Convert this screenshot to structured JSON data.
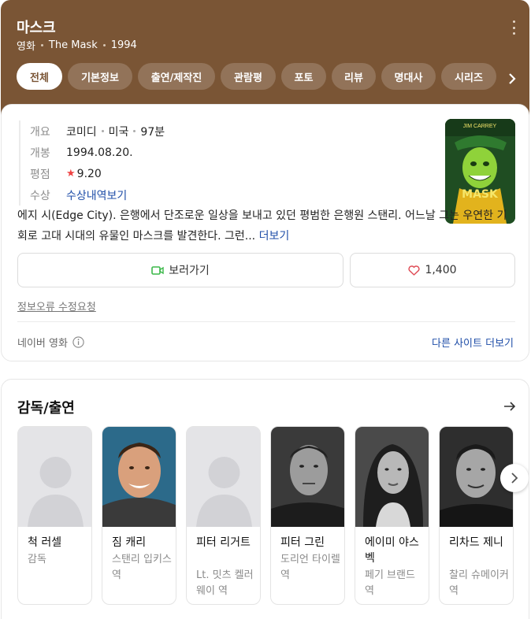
{
  "header": {
    "title": "마스크",
    "category": "영화",
    "original_title": "The Mask",
    "year": "1994",
    "more_icon": "more-vert-icon",
    "tabs": [
      {
        "label": "전체",
        "active": true
      },
      {
        "label": "기본정보",
        "active": false
      },
      {
        "label": "출연/제작진",
        "active": false
      },
      {
        "label": "관람평",
        "active": false
      },
      {
        "label": "포토",
        "active": false
      },
      {
        "label": "리뷰",
        "active": false
      },
      {
        "label": "명대사",
        "active": false
      },
      {
        "label": "시리즈",
        "active": false
      }
    ]
  },
  "info": {
    "overview_label": "개요",
    "genre": "코미디",
    "country": "미국",
    "runtime": "97분",
    "release_label": "개봉",
    "release_date": "1994.08.20.",
    "rating_label": "평점",
    "rating": "9.20",
    "award_label": "수상",
    "award_link": "수상내역보기",
    "poster_top_text": "JIM CARREY",
    "poster_title": "MASK"
  },
  "synopsis": {
    "text": "에지 시(Edge City). 은행에서 단조로운 일상을 보내고 있던 평범한 은행원 스탠리. 어느날 그는 우연한 기회로 고대 시대의 유물인 마스크를 발견한다. 그런...",
    "more_label": "더보기"
  },
  "actions": {
    "watch_label": "보러가기",
    "like_count": "1,400"
  },
  "footer": {
    "report_label": "정보오류 수정요청",
    "source_label": "네이버 영화",
    "other_sites_label": "다른 사이트 더보기"
  },
  "cast_section": {
    "title": "감독/출연",
    "people": [
      {
        "name": "척 러셀",
        "role": "감독",
        "photo": "placeholder"
      },
      {
        "name": "짐 캐리",
        "role": "스탠리 입키스 역",
        "photo": "color"
      },
      {
        "name": "피터 리거트",
        "role": "Lt. 밋츠 켈러웨이 역",
        "photo": "placeholder"
      },
      {
        "name": "피터 그린",
        "role": "도리언 타이렐 역",
        "photo": "bw"
      },
      {
        "name": "에이미 야스벡",
        "role": "페기 브랜드 역",
        "photo": "bw"
      },
      {
        "name": "리차드 제니",
        "role": "찰리 슈메이커 역",
        "photo": "bw"
      }
    ]
  },
  "colors": {
    "header_bg": "#7a5535",
    "link": "#1f4ea8",
    "star": "#ee4444",
    "watch_icon": "#3cb84a",
    "heart_icon": "#e0505a"
  }
}
